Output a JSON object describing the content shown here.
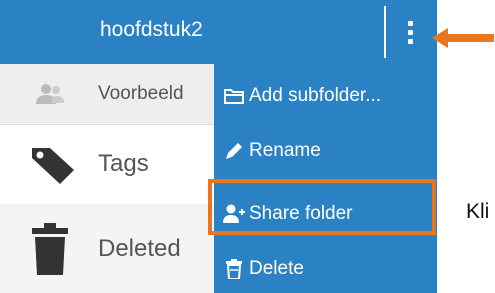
{
  "header": {
    "folder_title": "hoofdstuk2",
    "background_color": "#2a82c4",
    "kebab_icon": "vertical-dots-icon"
  },
  "annotation": {
    "arrow_color": "#e8761f",
    "highlight_color": "#e8761f",
    "side_text": "Kli"
  },
  "sidebar": {
    "items": [
      {
        "label": "Voorbeeld",
        "icon": "users-icon"
      },
      {
        "label": "Tags",
        "icon": "tag-icon"
      },
      {
        "label": "Deleted",
        "icon": "trash-icon"
      }
    ]
  },
  "context_menu": {
    "items": [
      {
        "label": "Add subfolder...",
        "icon": "folder-icon"
      },
      {
        "label": "Rename",
        "icon": "pencil-icon"
      },
      {
        "label": "Share folder",
        "icon": "user-plus-icon",
        "highlighted": true
      },
      {
        "label": "Delete",
        "icon": "trash-icon"
      }
    ]
  }
}
